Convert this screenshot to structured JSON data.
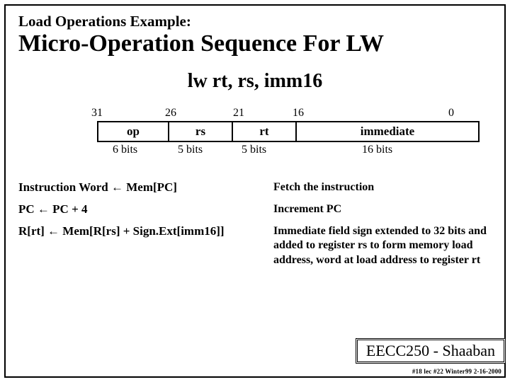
{
  "subtitle": "Load Operations Example:",
  "title": "Micro-Operation Sequence For  LW",
  "example": "lw rt, rs, imm16",
  "bits": {
    "b31": "31",
    "b26": "26",
    "b21": "21",
    "b16": "16",
    "b0": "0"
  },
  "fields": {
    "op": "op",
    "rs": "rs",
    "rt": "rt",
    "imm": "immediate"
  },
  "widths": {
    "op": "6 bits",
    "rs": "5 bits",
    "rt": "5 bits",
    "imm": "16 bits"
  },
  "steps": [
    {
      "lhs": "Instruction Word  ←    Mem[PC]",
      "rhs": "Fetch the instruction"
    },
    {
      "lhs": "PC  ←  PC + 4",
      "rhs": "Increment PC"
    },
    {
      "lhs": "R[rt]  ←  Mem[R[rs] + Sign.Ext[imm16]]",
      "rhs": "Immediate field sign extended to 32 bits and added to register  rs to form memory load address, word at load address to register  rt"
    }
  ],
  "footer": "EECC250 - Shaaban",
  "tiny": "#18 lec #22 Winter99  2-16-2000"
}
